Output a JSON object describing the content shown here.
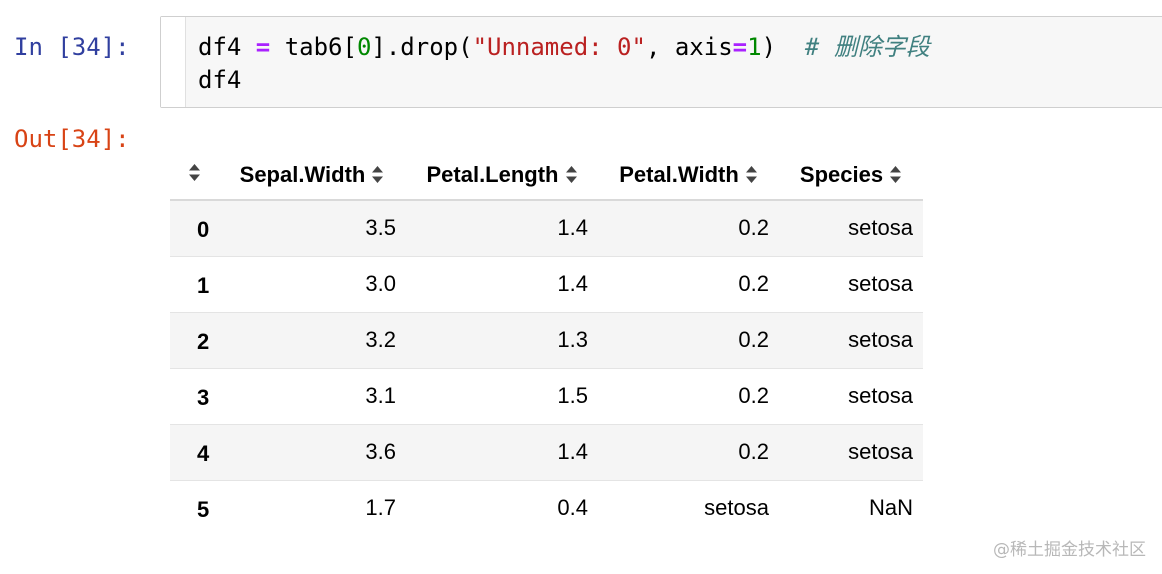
{
  "input_prompt": "In [34]:",
  "output_prompt": "Out[34]:",
  "code": {
    "line1": {
      "var": "df4 ",
      "eq": "=",
      "expr_a": " tab6[",
      "index": "0",
      "expr_b": "].drop(",
      "string": "\"Unnamed: 0\"",
      "expr_c": ", axis",
      "eq2": "=",
      "axis_val": "1",
      "expr_d": ")  ",
      "comment": "# 删除字段"
    },
    "line2": "df4"
  },
  "table": {
    "columns": [
      "Sepal.Width",
      "Petal.Length",
      "Petal.Width",
      "Species"
    ],
    "rows": [
      {
        "index": "0",
        "cells": [
          "3.5",
          "1.4",
          "0.2",
          "setosa"
        ]
      },
      {
        "index": "1",
        "cells": [
          "3.0",
          "1.4",
          "0.2",
          "setosa"
        ]
      },
      {
        "index": "2",
        "cells": [
          "3.2",
          "1.3",
          "0.2",
          "setosa"
        ]
      },
      {
        "index": "3",
        "cells": [
          "3.1",
          "1.5",
          "0.2",
          "setosa"
        ]
      },
      {
        "index": "4",
        "cells": [
          "3.6",
          "1.4",
          "0.2",
          "setosa"
        ]
      },
      {
        "index": "5",
        "cells": [
          "1.7",
          "0.4",
          "setosa",
          "NaN"
        ]
      }
    ]
  },
  "watermark": "@稀土掘金技术社区",
  "colors": {
    "input_prompt": "#303f9f",
    "output_prompt": "#d84315",
    "keyword_op": "#aa22ff",
    "number": "#008800",
    "string": "#ba2121",
    "comment": "#408080"
  },
  "icons": {
    "sort": "sort-updown-icon"
  }
}
